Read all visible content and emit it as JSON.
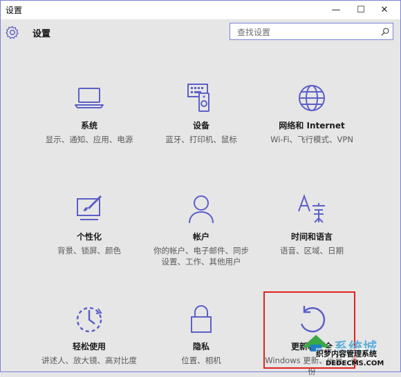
{
  "window": {
    "title": "设置",
    "controls": [
      "—",
      "☐",
      "✕"
    ]
  },
  "header": {
    "title": "设置",
    "search_placeholder": "查找设置"
  },
  "tiles": [
    {
      "name": "系统",
      "desc": "显示、通知、应用、电源",
      "icon": "laptop-icon"
    },
    {
      "name": "设备",
      "desc": "蓝牙、打印机、鼠标",
      "icon": "devices-icon"
    },
    {
      "name": "网络和 Internet",
      "desc": "Wi-Fi、飞行模式、VPN",
      "icon": "globe-icon"
    },
    {
      "name": "个性化",
      "desc": "背景、锁屏、颜色",
      "icon": "paint-icon"
    },
    {
      "name": "帐户",
      "desc": "你的帐户、电子邮件、同步设置、工作、其他用户",
      "icon": "person-icon"
    },
    {
      "name": "时间和语言",
      "desc": "语音、区域、日期",
      "icon": "time-language-icon"
    },
    {
      "name": "轻松使用",
      "desc": "讲述人、放大镜、高对比度",
      "icon": "ease-of-access-icon"
    },
    {
      "name": "隐私",
      "desc": "位置、相机",
      "icon": "lock-icon"
    },
    {
      "name": "更新和安全",
      "desc": "Windows 更新、恢复、备份",
      "icon": "refresh-icon"
    }
  ],
  "watermark": {
    "brand": "系统城",
    "sub": "织梦内容管理系统",
    "url": "DEDECMS.COM"
  },
  "colors": {
    "accent": "#5b5fc7",
    "highlight_box": "#e0211a"
  }
}
